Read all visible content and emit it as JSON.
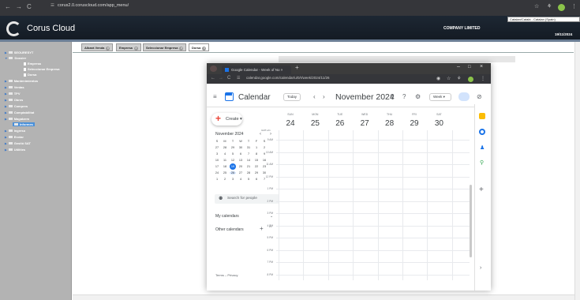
{
  "browser": {
    "url": "corus2.0.coruscloud.com/app_menu/",
    "nav": {
      "back": "←",
      "forward": "→",
      "reload": "C"
    }
  },
  "header": {
    "brand": "Corus Cloud",
    "company": "COMPANY LIMITED",
    "date": "19/11/2024",
    "language": "Catalan/Català - Catalan (Spain)"
  },
  "sidebar": {
    "items": [
      {
        "label": "SEOURESYT"
      },
      {
        "label": "Dossier"
      },
      {
        "label": "Empresa"
      },
      {
        "label": "Seleccionar Empresa"
      },
      {
        "label": "Dorsa"
      },
      {
        "label": "Mantenimientos"
      },
      {
        "label": "Ventas"
      },
      {
        "label": "TPV"
      },
      {
        "label": "Obres"
      },
      {
        "label": "Compres"
      },
      {
        "label": "Comptabilitat"
      },
      {
        "label": "Magatzem"
      },
      {
        "label": "Informes"
      },
      {
        "label": "Ingreso"
      },
      {
        "label": "Enviar"
      },
      {
        "label": "Gestió SAT"
      },
      {
        "label": "Utilities"
      }
    ]
  },
  "tabs": [
    {
      "label": "Albarà Venda"
    },
    {
      "label": "Empresa"
    },
    {
      "label": "Seleccionar Empresa"
    },
    {
      "label": "Dorsa"
    }
  ],
  "calendar_window": {
    "tab_title": "Google Calendar - Week of No",
    "url": "calendar.google.com/calendar/u/0/r/week/2024/11/26",
    "app_title": "Calendar",
    "today_label": "Today",
    "month_title": "November 2024",
    "view": "Week",
    "create_label": "Create",
    "mini_title": "November 2024",
    "mini_weekdays": [
      "S",
      "M",
      "T",
      "W",
      "T",
      "F",
      "S"
    ],
    "mini_weeks": [
      [
        "27",
        "28",
        "29",
        "30",
        "31",
        "1",
        "2"
      ],
      [
        "3",
        "4",
        "5",
        "6",
        "7",
        "8",
        "9"
      ],
      [
        "10",
        "11",
        "12",
        "13",
        "14",
        "15",
        "16"
      ],
      [
        "17",
        "18",
        "19",
        "20",
        "21",
        "22",
        "23"
      ],
      [
        "24",
        "25",
        "26",
        "27",
        "28",
        "29",
        "30"
      ],
      [
        "1",
        "2",
        "3",
        "4",
        "5",
        "6",
        "7"
      ]
    ],
    "search_people": "Search for people",
    "my_calendars": "My calendars",
    "other_calendars": "Other calendars",
    "terms": "Terms – Privacy",
    "gmt": "GMT+01",
    "days": [
      {
        "name": "SUN",
        "num": "24"
      },
      {
        "name": "MON",
        "num": "25"
      },
      {
        "name": "TUE",
        "num": "26"
      },
      {
        "name": "WED",
        "num": "27"
      },
      {
        "name": "THU",
        "num": "28"
      },
      {
        "name": "FRI",
        "num": "29"
      },
      {
        "name": "SAT",
        "num": "30"
      }
    ],
    "hours": [
      "9 AM",
      "10 AM",
      "11 AM",
      "12 PM",
      "1 PM",
      "2 PM",
      "3 PM",
      "4 PM",
      "5 PM",
      "6 PM",
      "7 PM",
      "8 PM"
    ]
  }
}
